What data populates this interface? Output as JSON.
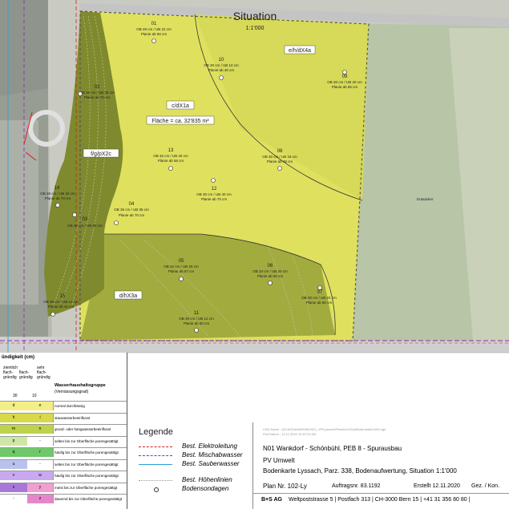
{
  "header": {
    "title": "Situation",
    "scale": "1:1'000"
  },
  "zones": [
    {
      "label": "e/h/dX4a"
    },
    {
      "label": "c/dX1a"
    },
    {
      "label": "f/g/pX2c"
    },
    {
      "label": "d/hX3a"
    }
  ],
  "area_label": "Fläche = ca. 32'835 m²",
  "grassland_label": "Grasacker",
  "sondagen": [
    {
      "id": "01",
      "ob": "OB 28 cm / UB 22 cm",
      "planie": "Planie ab 50 cm"
    },
    {
      "id": "02",
      "ob": "OB 35 cm / UB 35 cm",
      "planie": "Planie ab 70 cm"
    },
    {
      "id": "03",
      "ob": "OB 30 cm / UB 60 cm",
      "planie": ""
    },
    {
      "id": "04",
      "ob": "OB 35 cm / UB 35 cm",
      "planie": "Planie ab 70 cm"
    },
    {
      "id": "05",
      "ob": "OB 32 cm / UB 25 cm",
      "planie": "Planie ab 57 cm"
    },
    {
      "id": "06",
      "ob": "OB 33 cm / UB 20 cm",
      "planie": "Planie ab 60 cm"
    },
    {
      "id": "07",
      "ob": "OB 30 cm / UB 22 cm",
      "planie": "Planie ab 50 cm"
    },
    {
      "id": "08",
      "ob": "OB 30 cm / UB 18 cm",
      "planie": "Planie ab 48 cm"
    },
    {
      "id": "09",
      "ob": "OB 30 cm / UB 20 cm",
      "planie": "Planie ab 65 cm"
    },
    {
      "id": "10",
      "ob": "OB 30 cm / UB 10 cm",
      "planie": "Planie ab 40 cm"
    },
    {
      "id": "11",
      "ob": "OB 28 cm / UB 12 cm",
      "planie": "Planie ab 50 cm"
    },
    {
      "id": "12",
      "ob": "OB 30 cm / UB 40 cm",
      "planie": "Planie ab 70 cm"
    },
    {
      "id": "13",
      "ob": "OB 32 cm / UB 26 cm",
      "planie": "Planie ab 58 cm"
    },
    {
      "id": "14",
      "ob": "OB 38 cm / UB 32 cm",
      "planie": "Planie ab 70 cm"
    },
    {
      "id": "15",
      "ob": "OB 30 cm / UB 12 cm",
      "planie": "Planie ab 42 cm"
    }
  ],
  "legend": {
    "title": "Legende",
    "items": [
      {
        "label": "Best. Elektroleitung",
        "color": "#d42020",
        "style": "dashed"
      },
      {
        "label": "Best. Mischabwasser",
        "color": "#8a2bc0",
        "style": "dashed"
      },
      {
        "label": "Best. Sauberwasser",
        "color": "#2aa0d8",
        "style": "solid"
      },
      {
        "label": "Best. Höhenlinien",
        "color": "#9a9a9a",
        "style": "dotted"
      },
      {
        "label": "Bodensondagen",
        "color": "#333333",
        "style": "circle"
      }
    ]
  },
  "hydro_table": {
    "col_headers": [
      "ziemlich flach-gründig",
      "flach-gründig",
      "sehr flach-gründig"
    ],
    "group_title": "Wasserhaushaltsgruppe",
    "group_sub": "(Vernässungsgrad)",
    "header_partial": "ündigkeit (cm)",
    "depths": [
      "30",
      "10"
    ],
    "rows": [
      {
        "a": "d",
        "b": "e",
        "desc": "normal durchlässig",
        "c1": "#f3ef86",
        "c2": "#f3ef86"
      },
      {
        "a": "h",
        "b": "i",
        "desc": "stauwasserbeeinflusst",
        "c1": "#d7d94a",
        "c2": "#d7d94a"
      },
      {
        "a": "m",
        "b": "n",
        "desc": "grund- oder hangwasserbeeinflusst",
        "c1": "#bcd34a",
        "c2": "#bcd34a"
      },
      {
        "a": "p",
        "b": "-",
        "desc": "selten bis zur Oberfläche porengesättigt",
        "c1": "#cfe7a4",
        "c2": "#ffffff"
      },
      {
        "a": "q",
        "b": "r",
        "desc": "häufig bis zur Oberfläche porengesättigt",
        "c1": "#6fc86a",
        "c2": "#6fc86a"
      },
      {
        "a": "u",
        "b": "-",
        "desc": "selten bis zur Oberfläche porengesättigt",
        "c1": "#b9c2ef",
        "c2": "#ffffff"
      },
      {
        "a": "v",
        "b": "w",
        "desc": "häufig bis zur Oberfläche porengesättigt",
        "c1": "#c8a9f0",
        "c2": "#c8a9f0"
      },
      {
        "a": "x",
        "b": "y",
        "desc": "meist bis zur Oberfläche porengesättigt",
        "c1": "#a878d9",
        "c2": "#f0a0cf"
      },
      {
        "a": "-",
        "b": "z",
        "desc": "dauernd bis zur Oberfläche porengesättigt",
        "c1": "#ffffff",
        "c2": "#e486c9"
      }
    ]
  },
  "title_block": {
    "cad_name": "CAD Name : Q\\CADData\\83\\0811921_VP\\Lyssach\\Planes\\102xy\\Bodenkarte1000.dgn",
    "plot_datum": "Plot Datum : 12.11.2020 10:57:01 AM",
    "project": "N01 Wankdorf - Schönbühl, PEB 8 - Spurausbau",
    "section": "PV Umwelt",
    "subject": "Bodenkarte Lyssach, Parz. 338, Bodenaufwertung, Situation 1:1'000",
    "plan_nr": "Plan Nr. 102-Ly",
    "auftrag": "Auftragsnr. 83.1192",
    "erstellt": "Erstellt 12.11.2020",
    "gez": "Gez. / Kon.",
    "firm": "B+S AG",
    "address": "Weltpoststrasse 5 | Postfach 313 | CH-3000 Bern 15 | +41 31 356 80 80 |"
  },
  "colors": {
    "yellow_zone": "#dfe15e",
    "olive_zone": "#9ba33c",
    "dark_olive": "#7f8a2e",
    "meadow": "#b9c6a8",
    "road": "#c7c7c7"
  }
}
